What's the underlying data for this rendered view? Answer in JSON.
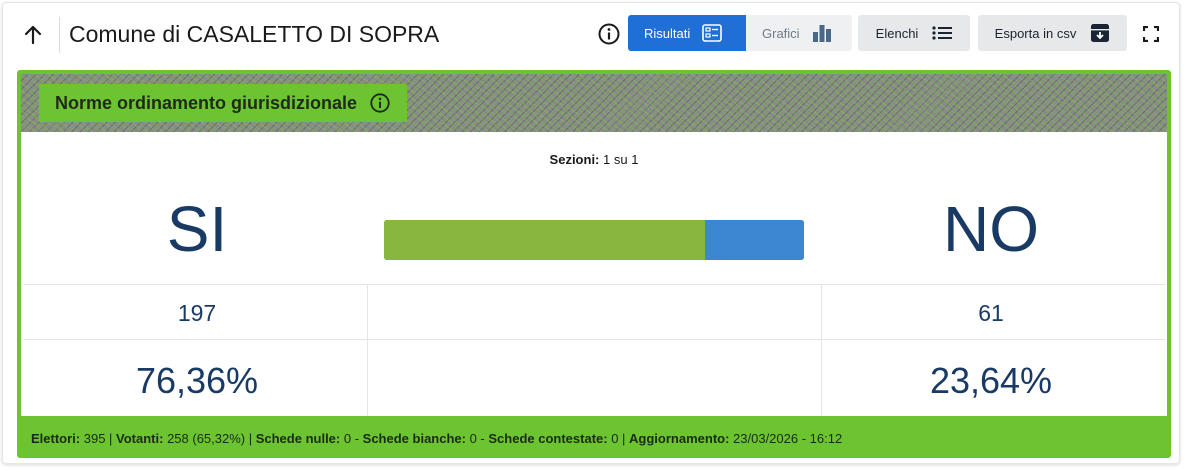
{
  "header": {
    "title": "Comune di CASALETTO DI SOPRA",
    "tabs": [
      {
        "label": "Risultati",
        "icon": "list-view-icon",
        "active": true
      },
      {
        "label": "Grafici",
        "icon": "bar-chart-icon",
        "active": false
      }
    ],
    "lists_label": "Elenchi",
    "export_label": "Esporta in csv"
  },
  "question": {
    "title": "Norme ordinamento giurisdizionale"
  },
  "sections": {
    "label": "Sezioni:",
    "value": "1 su 1"
  },
  "results": {
    "yes": {
      "label": "SI",
      "votes": "197",
      "percent": "76,36%",
      "share": 0.7636
    },
    "no": {
      "label": "NO",
      "votes": "61",
      "percent": "23,64%",
      "share": 0.2364
    }
  },
  "footer": {
    "electors_label": "Elettori:",
    "electors_value": " 395 | ",
    "voters_label": "Votanti:",
    "voters_value": " 258 (65,32%) | ",
    "null_label": "Schede nulle:",
    "null_value": " 0 - ",
    "blank_label": "Schede bianche:",
    "blank_value": " 0 - ",
    "contested_label": "Schede contestate:",
    "contested_value": " 0 | ",
    "updated_label": "Aggiornamento:",
    "updated_value": " 23/03/2026 - 16:12"
  },
  "colors": {
    "primary": "#1f6fd6",
    "panel_green": "#6cc530",
    "bar_yes": "#88b63e",
    "bar_no": "#3d86d0",
    "value_text": "#1a3a66"
  }
}
